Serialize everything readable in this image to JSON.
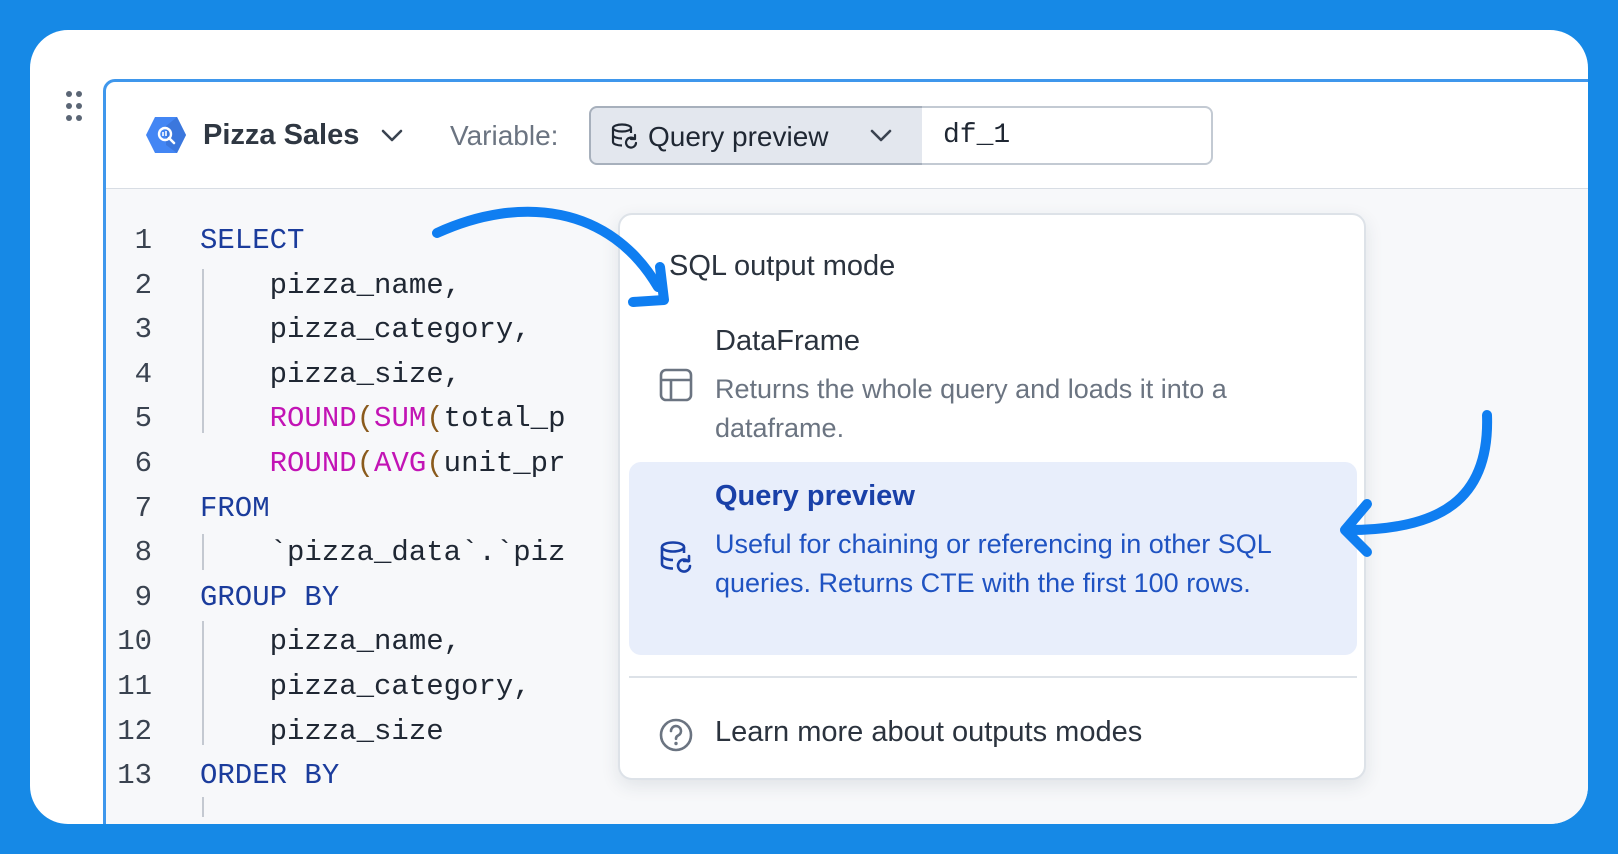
{
  "header": {
    "source_name": "Pizza Sales",
    "variable_label": "Variable:",
    "output_mode_selected": "Query preview",
    "variable_value": "df_1"
  },
  "code": {
    "lines": [
      {
        "num": "1",
        "text": "SELECT"
      },
      {
        "num": "2",
        "text": "    pizza_name,"
      },
      {
        "num": "3",
        "text": "    pizza_category,"
      },
      {
        "num": "4",
        "text": "    pizza_size,"
      },
      {
        "num": "5",
        "text": "    ROUND(SUM(total_p"
      },
      {
        "num": "6",
        "text": "    ROUND(AVG(unit_pr"
      },
      {
        "num": "7",
        "text": "FROM"
      },
      {
        "num": "8",
        "text": "    `pizza_data`.`piz"
      },
      {
        "num": "9",
        "text": "GROUP BY"
      },
      {
        "num": "10",
        "text": "    pizza_name,"
      },
      {
        "num": "11",
        "text": "    pizza_category,"
      },
      {
        "num": "12",
        "text": "    pizza_size"
      },
      {
        "num": "13",
        "text": "ORDER BY"
      }
    ],
    "keyword_color": "#1b3c9c",
    "function_color": "#c214b5"
  },
  "menu": {
    "heading": "SQL output mode",
    "options": [
      {
        "title": "DataFrame",
        "description": "Returns the whole query and loads it into a dataframe.",
        "icon": "table-icon",
        "selected": false
      },
      {
        "title": "Query preview",
        "description": "Useful for chaining or referencing in other SQL queries. Returns CTE with the first 100 rows.",
        "icon": "database-refresh-icon",
        "selected": true
      }
    ],
    "learn_more": "Learn more about outputs modes",
    "learn_more_icon": "help-circle-icon"
  },
  "colors": {
    "background": "#1689e6",
    "accent": "#3f97ec",
    "selected_option_bg": "#e8eefb",
    "selected_option_text": "#1940a8",
    "annotation_arrow": "#0f7ef1"
  }
}
